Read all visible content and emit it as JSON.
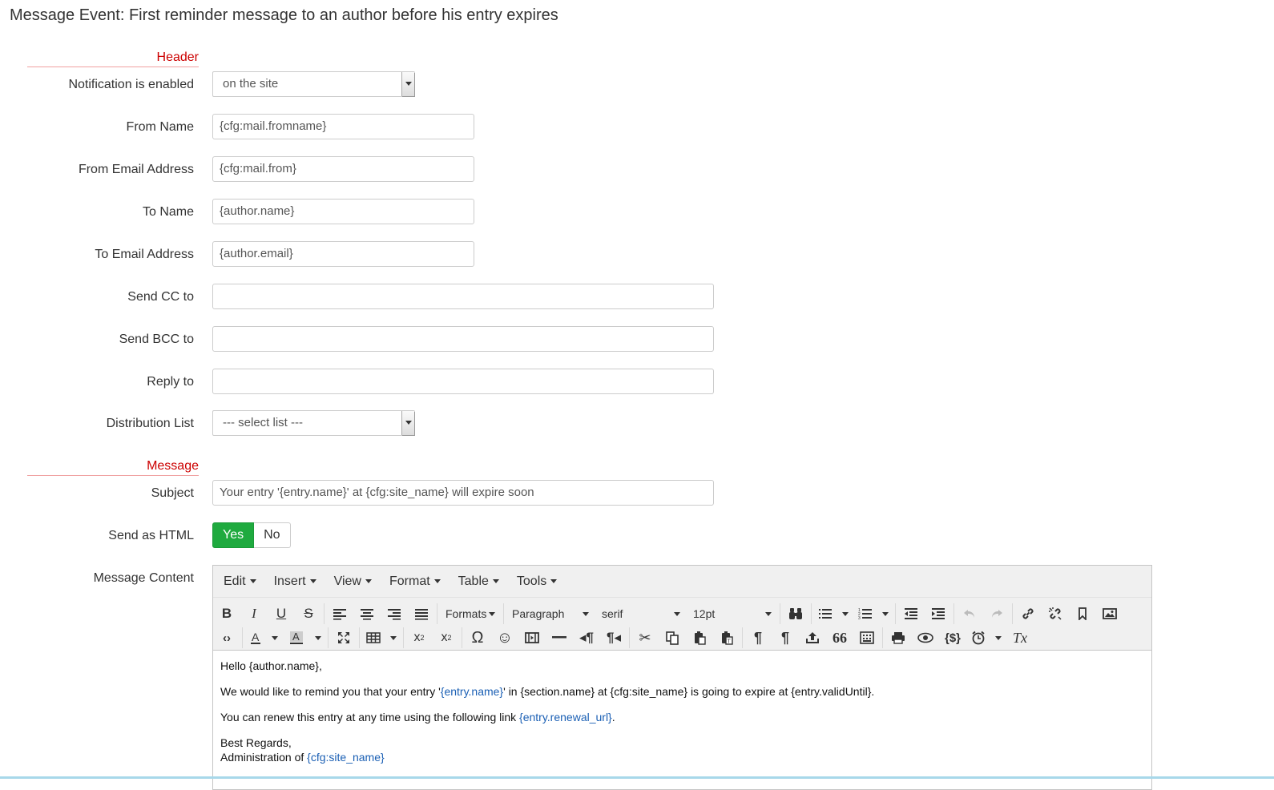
{
  "page": {
    "title": "Message Event: First reminder message to an author before his entry expires"
  },
  "sections": {
    "header": "Header",
    "message": "Message"
  },
  "fields": {
    "notification": {
      "label": "Notification is enabled",
      "value": "on the site"
    },
    "from_name": {
      "label": "From Name",
      "value": "{cfg:mail.fromname}"
    },
    "from_email": {
      "label": "From Email Address",
      "value": "{cfg:mail.from}"
    },
    "to_name": {
      "label": "To Name",
      "value": "{author.name}"
    },
    "to_email": {
      "label": "To Email Address",
      "value": "{author.email}"
    },
    "cc": {
      "label": "Send CC to",
      "value": ""
    },
    "bcc": {
      "label": "Send BCC to",
      "value": ""
    },
    "reply_to": {
      "label": "Reply to",
      "value": ""
    },
    "distribution": {
      "label": "Distribution List",
      "value": "--- select list ---"
    },
    "subject": {
      "label": "Subject",
      "value": "Your entry '{entry.name}' at {cfg:site_name} will expire soon"
    },
    "send_html": {
      "label": "Send as HTML",
      "yes": "Yes",
      "no": "No",
      "selected": "Yes"
    },
    "content": {
      "label": "Message Content"
    }
  },
  "editor": {
    "menus": [
      "Edit",
      "Insert",
      "View",
      "Format",
      "Table",
      "Tools"
    ],
    "dropdowns": {
      "formats": "Formats",
      "block": "Paragraph",
      "font": "serif",
      "size": "12pt"
    },
    "icons": {
      "bold": "B",
      "italic": "I",
      "underline": "U",
      "strike": "S",
      "omega": "Ω",
      "emoji": "☺",
      "pilcrow": "¶",
      "quote": "66",
      "vars": "{$}",
      "clear": "Tx"
    },
    "body": {
      "greeting": "Hello {author.name},",
      "line1_pre": "We would like to remind you that your entry '",
      "line1_var": "{entry.name}",
      "line1_post": "' in {section.name} at {cfg:site_name} is going to expire at {entry.validUntil}.",
      "line2_pre": "You can renew this entry at any time using the following link ",
      "line2_var": "{entry.renewal_url}",
      "line2_post": ".",
      "regards": "Best Regards,",
      "admin_pre": "Administration of ",
      "admin_var": "{cfg:site_name}"
    }
  },
  "colors": {
    "accent_red": "#cc0000",
    "toggle_green": "#1faa3f",
    "variable_blue": "#1a5fb4"
  }
}
